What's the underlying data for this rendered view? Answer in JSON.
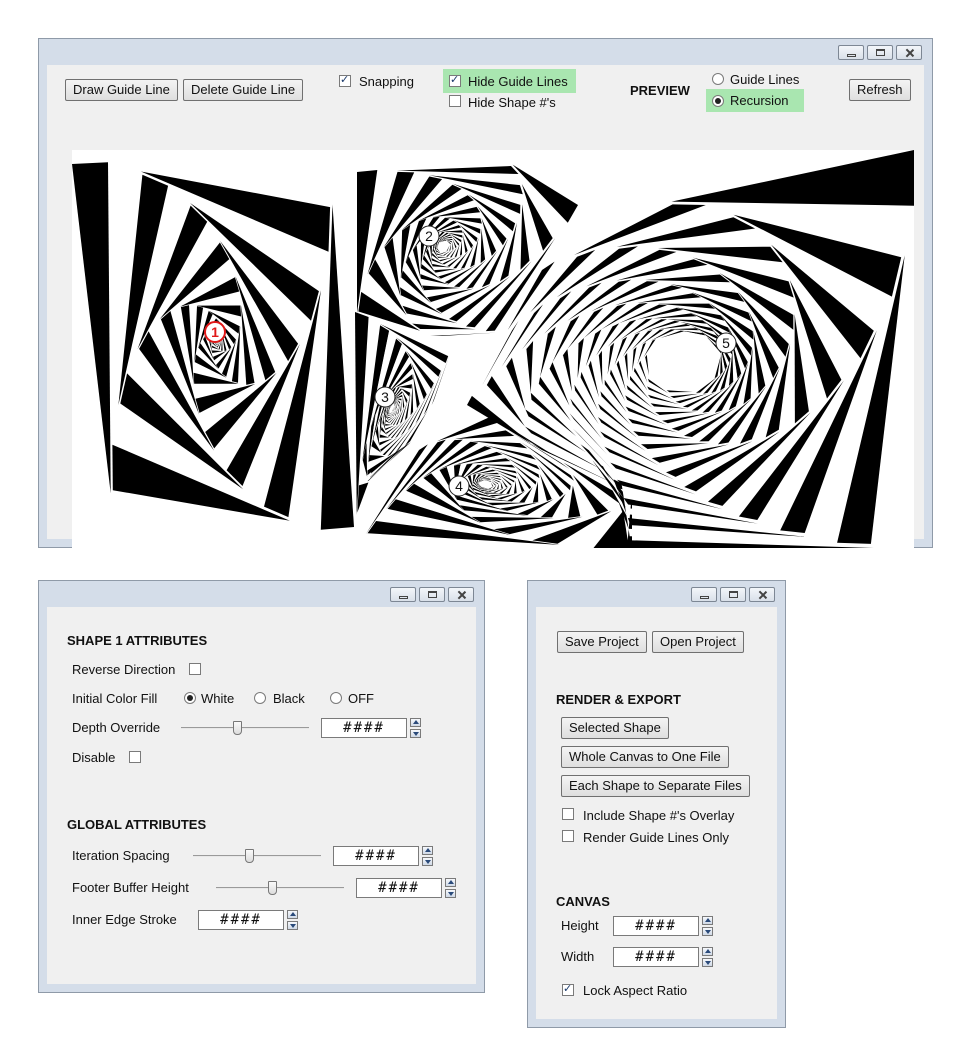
{
  "main_window": {
    "toolbar": {
      "draw_guide_line": "Draw Guide Line",
      "delete_guide_line": "Delete Guide Line",
      "snapping": {
        "label": "Snapping",
        "checked": true
      },
      "hide_guide_lines": {
        "label": "Hide Guide Lines",
        "checked": true
      },
      "hide_shape_numbers": {
        "label": "Hide Shape #'s",
        "checked": false
      },
      "preview_label": "PREVIEW",
      "preview_options": [
        {
          "label": "Guide Lines",
          "selected": false
        },
        {
          "label": "Recursion",
          "selected": true
        }
      ],
      "refresh": "Refresh"
    },
    "canvas": {
      "shape_numbers": [
        "1",
        "2",
        "3",
        "4",
        "5"
      ],
      "selected_shape": "1",
      "selected_color": "#e01818"
    }
  },
  "shape_window": {
    "shape_header": "SHAPE 1 ATTRIBUTES",
    "reverse_direction": {
      "label": "Reverse Direction",
      "checked": false
    },
    "initial_color_fill": {
      "label": "Initial Color Fill",
      "options": [
        {
          "label": "White",
          "selected": true
        },
        {
          "label": "Black",
          "selected": false
        },
        {
          "label": "OFF",
          "selected": false
        }
      ]
    },
    "depth_override": {
      "label": "Depth Override",
      "value": "####"
    },
    "disable": {
      "label": "Disable",
      "checked": false
    },
    "global_header": "GLOBAL ATTRIBUTES",
    "iteration_spacing": {
      "label": "Iteration Spacing",
      "value": "####"
    },
    "footer_buffer_height": {
      "label": "Footer Buffer Height",
      "value": "####"
    },
    "inner_edge_stroke": {
      "label": "Inner Edge Stroke",
      "value": "####"
    }
  },
  "export_window": {
    "save_project": "Save Project",
    "open_project": "Open Project",
    "render_header": "RENDER & EXPORT",
    "selected_shape": "Selected Shape",
    "whole_canvas": "Whole Canvas to One File",
    "each_shape": "Each Shape to Separate Files",
    "include_overlay": {
      "label": "Include Shape #'s Overlay",
      "checked": false
    },
    "guide_lines_only": {
      "label": "Render Guide Lines Only",
      "checked": false
    },
    "canvas_header": "CANVAS",
    "height": {
      "label": "Height",
      "value": "####"
    },
    "width": {
      "label": "Width",
      "value": "####"
    },
    "lock_aspect": {
      "label": "Lock Aspect Ratio",
      "checked": true
    }
  },
  "theme": {
    "window_frame": "#d4dde9",
    "panel_bg": "#f0f0f0",
    "highlight": "#a9e6b0"
  }
}
